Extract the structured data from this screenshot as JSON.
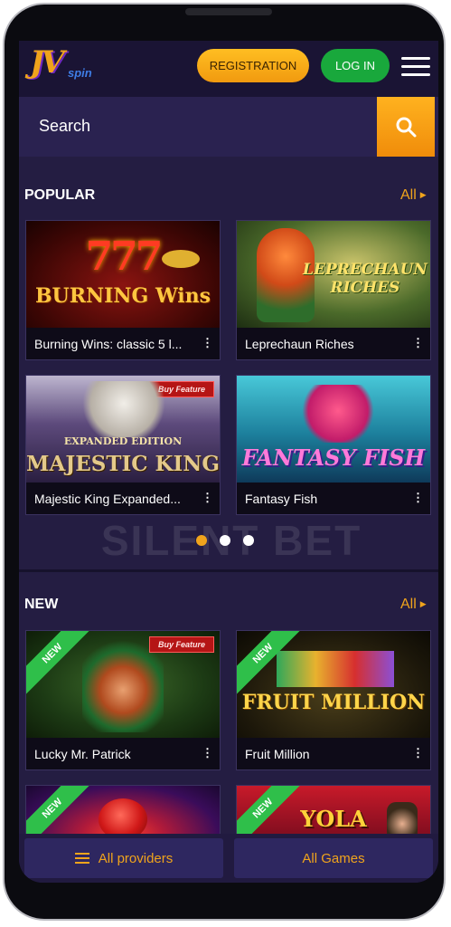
{
  "header": {
    "logo_text": "JV",
    "logo_subtext": "spin",
    "registration_label": "REGISTRATION",
    "login_label": "LOG IN",
    "menu_icon": "hamburger-menu-icon"
  },
  "search": {
    "placeholder": "Search",
    "icon": "search-icon"
  },
  "popular": {
    "title": "POPULAR",
    "all_label": "All",
    "games": [
      {
        "name": "Burning Wins: classic 5 l...",
        "art_text": "777",
        "art_sub": "BURNING Wins"
      },
      {
        "name": "Leprechaun Riches",
        "art_text": "LEPRECHAUN RICHES"
      },
      {
        "name": "Majestic King Expanded...",
        "art_text": "MAJESTIC KING",
        "art_sub": "EXPANDED EDITION",
        "tag": "Buy Feature"
      },
      {
        "name": "Fantasy Fish",
        "art_text": "FANTASY FISH"
      }
    ]
  },
  "carousel": {
    "dot_count": 3,
    "active_index": 0
  },
  "watermark": "SILENT BET",
  "new": {
    "title": "NEW",
    "all_label": "All",
    "ribbon_label": "NEW",
    "games": [
      {
        "name": "Lucky Mr. Patrick",
        "tag": "Buy Feature"
      },
      {
        "name": "Fruit Million",
        "art_text": "FRUIT MILLION"
      },
      {
        "name": ""
      },
      {
        "name": "",
        "art_text": "YOLA"
      }
    ]
  },
  "footer": {
    "providers_label": "All providers",
    "games_label": "All Games"
  },
  "colors": {
    "accent": "#f0a41c",
    "login_green": "#19a83c",
    "background": "#241d42",
    "new_ribbon": "#2fbf4a"
  }
}
